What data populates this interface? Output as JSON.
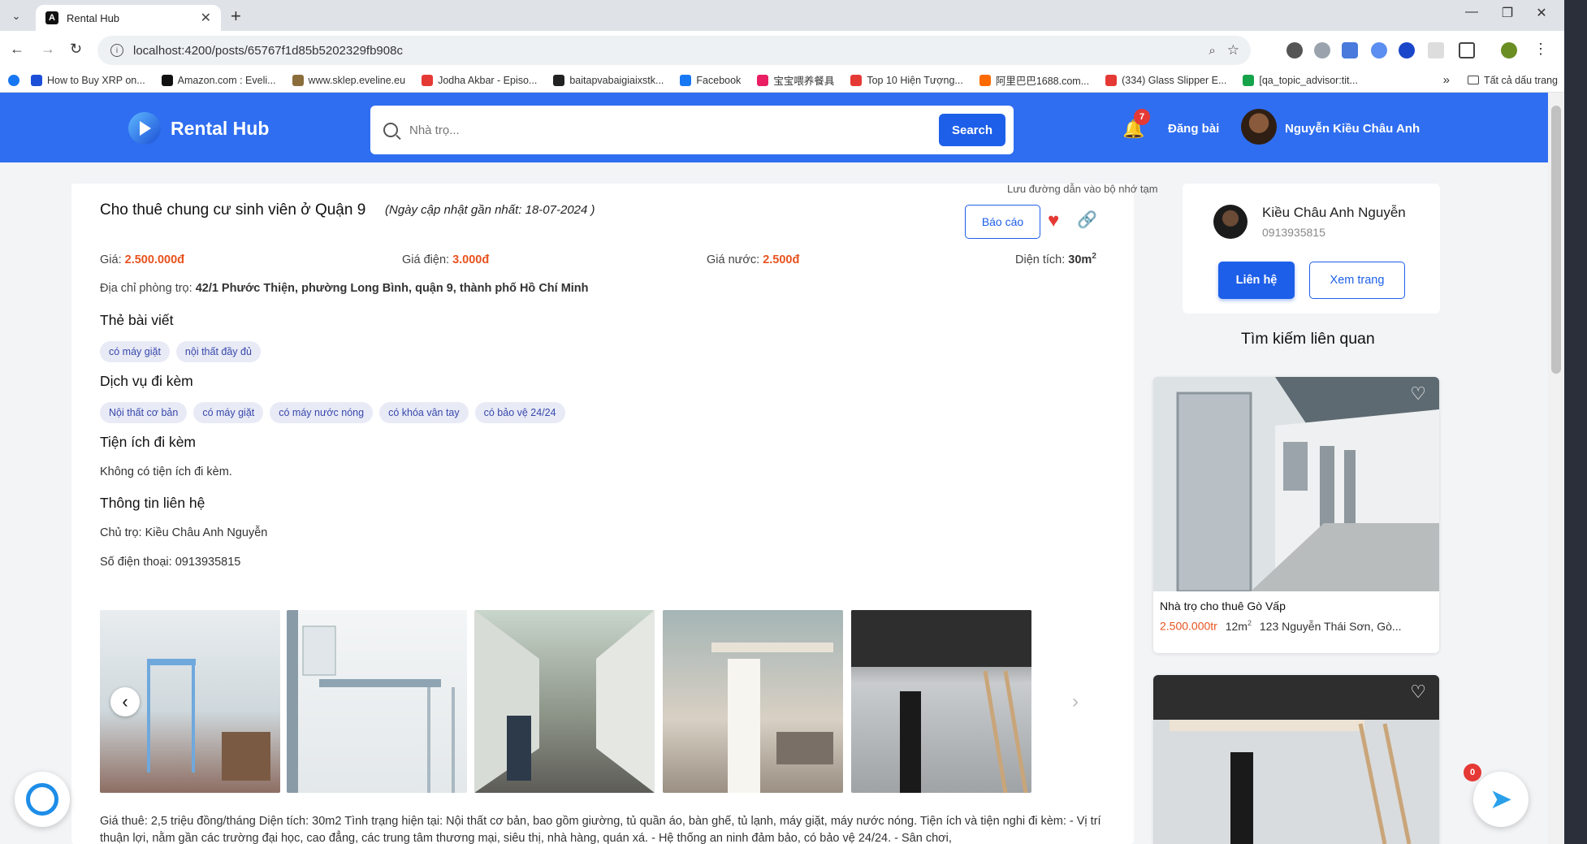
{
  "browser": {
    "tab_title": "Rental Hub",
    "tab_icon": "angular-icon",
    "url": "localhost:4200/posts/65767f1d85b5202329fb908c",
    "bookmarks": [
      {
        "label": "How to Buy XRP on...",
        "color": "#1d4ed8"
      },
      {
        "label": "Amazon.com : Eveli...",
        "color": "#111111"
      },
      {
        "label": "www.sklep.eveline.eu",
        "color": "#8a6d3b"
      },
      {
        "label": "Jodha Akbar - Episo...",
        "color": "#e53935"
      },
      {
        "label": "baitapvabaigiaixstk...",
        "color": "#222222"
      },
      {
        "label": "Facebook",
        "color": "#1877f2"
      },
      {
        "label": "宝宝喂养餐具",
        "color": "#e91e63"
      },
      {
        "label": "Top 10 Hiện Tượng...",
        "color": "#e53935"
      },
      {
        "label": "阿里巴巴1688.com...",
        "color": "#ff6a00"
      },
      {
        "label": "(334) Glass Slipper E...",
        "color": "#e53935"
      },
      {
        "label": "[qa_topic_advisor:tit...",
        "color": "#16a34a"
      }
    ],
    "more_bookmarks": "»",
    "all_bookmarks": "Tất cả dấu trang"
  },
  "header": {
    "logo_text": "Rental Hub",
    "search_placeholder": "Nhà trọ...",
    "search_button": "Search",
    "notification_count": "7",
    "post_link": "Đăng bài",
    "user_name": "Nguyễn Kiều Châu Anh"
  },
  "post": {
    "title": "Cho thuê chung cư sinh viên ở Quận 9",
    "updated": "(Ngày cập nhật gần nhất: 18-07-2024 )",
    "report_button": "Báo cáo",
    "copy_tooltip": "Lưu đường dẫn vào bộ nhớ tạm",
    "price_label": "Giá:",
    "price_value": "2.500.000đ",
    "electric_label": "Giá điện:",
    "electric_value": "3.000đ",
    "water_label": "Giá nước:",
    "water_value": "2.500đ",
    "area_label": "Diện tích:",
    "area_value": "30m",
    "area_sup": "2",
    "address_label": "Địa chỉ phòng trọ:",
    "address_value": "42/1 Phước Thiện, phường Long Bình, quận 9, thành phố Hồ Chí Minh",
    "tags_heading": "Thẻ bài viết",
    "tags": [
      "có máy giặt",
      "nội thất đầy đủ"
    ],
    "services_heading": "Dịch vụ đi kèm",
    "services": [
      "Nội thất cơ bản",
      "có máy giặt",
      "có máy nước nóng",
      "có khóa vân tay",
      "có bảo vệ 24/24"
    ],
    "amenities_heading": "Tiện ích đi kèm",
    "amenities_text": "Không có tiện ích đi kèm.",
    "contact_heading": "Thông tin liên hệ",
    "owner_line": "Chủ trọ: Kiều Châu Anh Nguyễn",
    "phone_line": "Số điện thoại: 0913935815",
    "prev_arrow": "‹",
    "next_arrow": "›",
    "description": "Giá thuê: 2,5 triệu đồng/tháng Diện tích: 30m2 Tình trạng hiện tại: Nội thất cơ bản, bao gồm giường, tủ quần áo, bàn ghế, tủ lạnh, máy giặt, máy nước nóng. Tiện ích và tiện nghi đi kèm: - Vị trí thuận lợi, nằm gần các trường đại học, cao đẳng, các trung tâm thương mại, siêu thị, nhà hàng, quán xá. - Hệ thống an ninh đảm bảo, có bảo vệ 24/24. - Sân chơi,"
  },
  "owner": {
    "name": "Kiều Châu Anh Nguyễn",
    "phone": "0913935815",
    "contact_button": "Liên hệ",
    "view_button": "Xem trang"
  },
  "related": {
    "heading": "Tìm kiếm liên quan",
    "items": [
      {
        "title": "Nhà trọ cho thuê Gò Vấp",
        "price": "2.500.000tr",
        "area": "12m",
        "area_sup": "2",
        "address": "123 Nguyễn Thái Sơn, Gò..."
      }
    ]
  },
  "floating": {
    "telegram_badge": "0"
  },
  "colors": {
    "brand_blue": "#2f6ef0",
    "button_blue": "#1d5fe8",
    "price_orange": "#e8531f",
    "heart_red": "#e53935",
    "chip_bg": "#e8eaf6"
  }
}
